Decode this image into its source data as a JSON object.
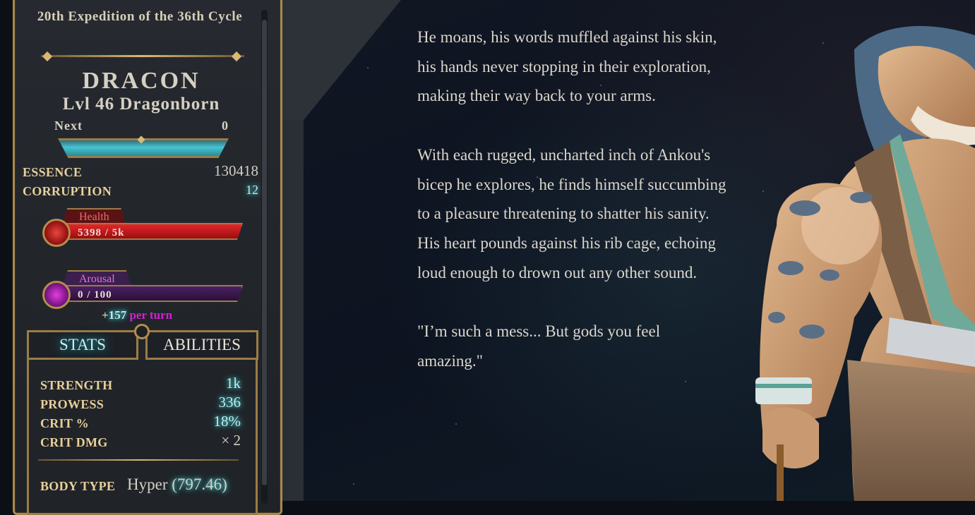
{
  "sidebar": {
    "expedition": "20th Expedition of the 36th Cycle",
    "name": "DRACON",
    "level": "Lvl 46 Dragonborn",
    "next_label": "Next",
    "next_value": "0",
    "xp_fraction": 1.0,
    "essence_label": "ESSENCE",
    "essence_value": "130418",
    "corruption_label": "CORRUPTION",
    "corruption_value": "12",
    "health": {
      "label": "Health",
      "text": "5398 / 5k",
      "fraction": 1.0
    },
    "arousal": {
      "label": "Arousal",
      "text": "0 / 100",
      "fraction": 0.0
    },
    "per_turn_prefix": "+",
    "per_turn_value": "157",
    "per_turn_suffix": "per turn",
    "tabs": {
      "stats": "STATS",
      "abilities": "ABILITIES"
    },
    "stats": [
      {
        "label": "STRENGTH",
        "value": "1k"
      },
      {
        "label": "PROWESS",
        "value": "336"
      },
      {
        "label": "CRIT %",
        "value": "18%"
      },
      {
        "label": "CRIT DMG",
        "value": "× 2"
      }
    ],
    "body_type_label": "BODY TYPE",
    "body_type_value": "Hyper",
    "body_type_number": "(797.46)"
  },
  "story": {
    "paragraphs": [
      "He moans, his words muffled against his skin, his hands never stopping in their exploration, making their way back to your arms.",
      "With each rugged, uncharted inch of Ankou's bicep he explores, he finds himself succumbing to a pleasure threatening to shatter his sanity.",
      "His heart pounds against his rib cage, echoing loud enough to drown out any other sound.",
      "\"I’m such a mess... But gods you feel amazing.\""
    ]
  },
  "colors": {
    "gold": "#a8884e",
    "label_gold": "#e9cf9a",
    "health_red": "#c8141a",
    "arousal_purple": "#5a1e6a",
    "xp_cyan": "#48c4d1",
    "per_turn_magenta": "#d61fd0"
  }
}
